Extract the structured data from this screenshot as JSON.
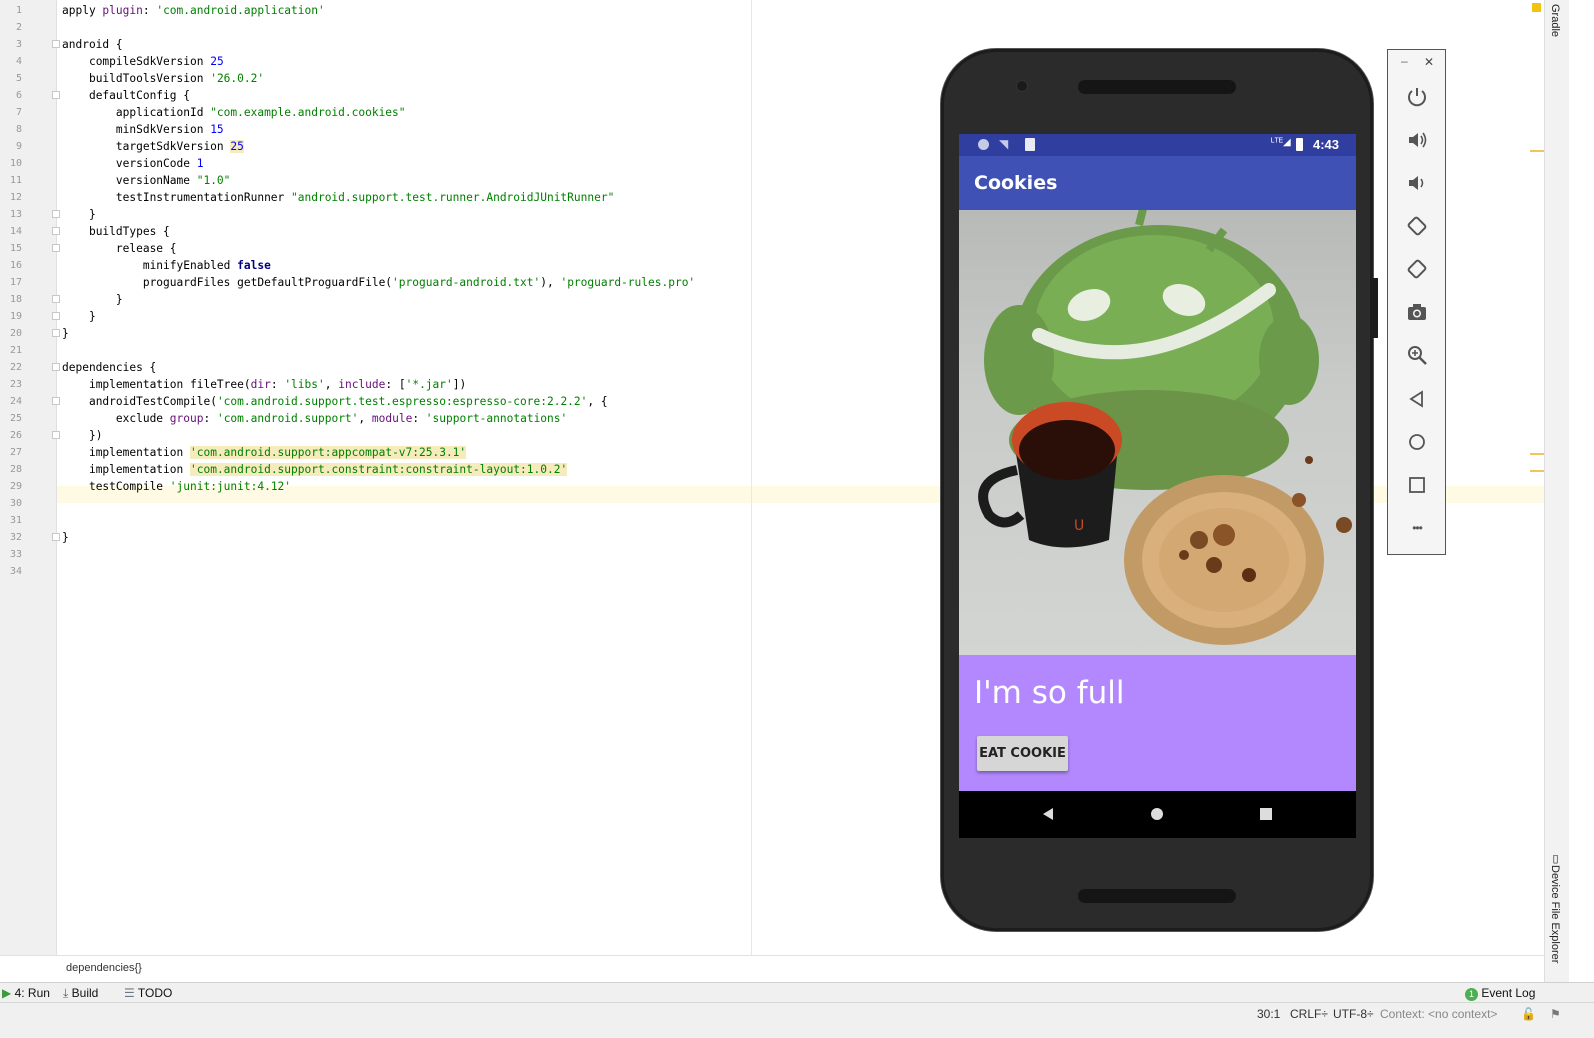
{
  "editor": {
    "line_numbers": [
      "1",
      "2",
      "3",
      "4",
      "5",
      "6",
      "7",
      "8",
      "9",
      "10",
      "11",
      "12",
      "13",
      "14",
      "15",
      "16",
      "17",
      "18",
      "19",
      "20",
      "21",
      "22",
      "23",
      "24",
      "25",
      "26",
      "27",
      "28",
      "29",
      "30",
      "31",
      "32",
      "33",
      "34"
    ],
    "lines": [
      {
        "n": 1,
        "indent": "",
        "parts": [
          [
            "",
            "apply "
          ],
          [
            "prop",
            "plugin"
          ],
          [
            "",
            ": "
          ],
          [
            "str",
            "'com.android.application'"
          ]
        ]
      },
      {
        "n": 2,
        "indent": "",
        "parts": []
      },
      {
        "n": 3,
        "indent": "",
        "parts": [
          [
            "",
            "android {"
          ]
        ]
      },
      {
        "n": 4,
        "indent": "    ",
        "parts": [
          [
            "",
            "compileSdkVersion "
          ],
          [
            "num",
            "25"
          ]
        ]
      },
      {
        "n": 5,
        "indent": "    ",
        "parts": [
          [
            "",
            "buildToolsVersion "
          ],
          [
            "str",
            "'26.0.2'"
          ]
        ]
      },
      {
        "n": 6,
        "indent": "    ",
        "parts": [
          [
            "",
            "defaultConfig {"
          ]
        ]
      },
      {
        "n": 7,
        "indent": "        ",
        "parts": [
          [
            "",
            "applicationId "
          ],
          [
            "str",
            "\"com.example.android.cookies\""
          ]
        ]
      },
      {
        "n": 8,
        "indent": "        ",
        "parts": [
          [
            "",
            "minSdkVersion "
          ],
          [
            "num",
            "15"
          ]
        ]
      },
      {
        "n": 9,
        "indent": "        ",
        "parts": [
          [
            "",
            "targetSdkVersion "
          ],
          [
            "num hl",
            "25"
          ]
        ]
      },
      {
        "n": 10,
        "indent": "        ",
        "parts": [
          [
            "",
            "versionCode "
          ],
          [
            "num",
            "1"
          ]
        ]
      },
      {
        "n": 11,
        "indent": "        ",
        "parts": [
          [
            "",
            "versionName "
          ],
          [
            "str",
            "\"1.0\""
          ]
        ]
      },
      {
        "n": 12,
        "indent": "        ",
        "parts": [
          [
            "",
            "testInstrumentationRunner "
          ],
          [
            "str",
            "\"android.support.test.runner.AndroidJUnitRunner\""
          ]
        ]
      },
      {
        "n": 13,
        "indent": "    ",
        "parts": [
          [
            "",
            "}"
          ]
        ]
      },
      {
        "n": 14,
        "indent": "    ",
        "parts": [
          [
            "",
            "buildTypes {"
          ]
        ]
      },
      {
        "n": 15,
        "indent": "        ",
        "parts": [
          [
            "",
            "release {"
          ]
        ]
      },
      {
        "n": 16,
        "indent": "            ",
        "parts": [
          [
            "",
            "minifyEnabled "
          ],
          [
            "kw",
            "false"
          ]
        ]
      },
      {
        "n": 17,
        "indent": "            ",
        "parts": [
          [
            "",
            "proguardFiles getDefaultProguardFile("
          ],
          [
            "str",
            "'proguard-android.txt'"
          ],
          [
            "",
            "), "
          ],
          [
            "str",
            "'proguard-rules.pro'"
          ]
        ]
      },
      {
        "n": 18,
        "indent": "        ",
        "parts": [
          [
            "",
            "}"
          ]
        ]
      },
      {
        "n": 19,
        "indent": "    ",
        "parts": [
          [
            "",
            "}"
          ]
        ]
      },
      {
        "n": 20,
        "indent": "",
        "parts": [
          [
            "",
            "}"
          ]
        ]
      },
      {
        "n": 21,
        "indent": "",
        "parts": []
      },
      {
        "n": 22,
        "indent": "",
        "parts": [
          [
            "",
            "dependencies {"
          ]
        ]
      },
      {
        "n": 23,
        "indent": "    ",
        "parts": [
          [
            "",
            "implementation fileTree("
          ],
          [
            "prop",
            "dir"
          ],
          [
            "",
            ": "
          ],
          [
            "str",
            "'libs'"
          ],
          [
            "",
            ", "
          ],
          [
            "prop",
            "include"
          ],
          [
            "",
            ": ["
          ],
          [
            "str",
            "'*.jar'"
          ],
          [
            "",
            "])"
          ]
        ]
      },
      {
        "n": 24,
        "indent": "    ",
        "parts": [
          [
            "",
            "androidTestCompile("
          ],
          [
            "str",
            "'com.android.support.test.espresso:espresso-core:2.2.2'"
          ],
          [
            "",
            ", {"
          ]
        ]
      },
      {
        "n": 25,
        "indent": "        ",
        "parts": [
          [
            "",
            "exclude "
          ],
          [
            "prop",
            "group"
          ],
          [
            "",
            ": "
          ],
          [
            "str",
            "'com.android.support'"
          ],
          [
            "",
            ", "
          ],
          [
            "prop",
            "module"
          ],
          [
            "",
            ": "
          ],
          [
            "str",
            "'support-annotations'"
          ]
        ]
      },
      {
        "n": 26,
        "indent": "    ",
        "parts": [
          [
            "",
            "})"
          ]
        ]
      },
      {
        "n": 27,
        "indent": "    ",
        "parts": [
          [
            "",
            "implementation "
          ],
          [
            "str hl",
            "'com.android.support:appcompat-v7:25.3.1'"
          ]
        ]
      },
      {
        "n": 28,
        "indent": "    ",
        "parts": [
          [
            "",
            "implementation "
          ],
          [
            "str hl",
            "'com.android.support.constraint:constraint-layout:1.0.2'"
          ]
        ]
      },
      {
        "n": 29,
        "indent": "    ",
        "parts": [
          [
            "",
            "testCompile "
          ],
          [
            "str",
            "'junit:junit:4.12'"
          ]
        ]
      },
      {
        "n": 30,
        "indent": "",
        "parts": []
      },
      {
        "n": 31,
        "indent": "",
        "parts": []
      },
      {
        "n": 32,
        "indent": "",
        "parts": [
          [
            "",
            "}"
          ]
        ]
      },
      {
        "n": 33,
        "indent": "",
        "parts": []
      },
      {
        "n": 34,
        "indent": "",
        "parts": []
      }
    ],
    "breadcrumb": "dependencies{}"
  },
  "right_tools": {
    "gradle": "Gradle",
    "device_explorer": "Device File Explorer"
  },
  "bottom_tools": {
    "run": "4: Run",
    "build": "Build",
    "todo": "TODO",
    "event_log": "Event Log",
    "event_count": "1"
  },
  "status": {
    "position": "30:1",
    "line_sep": "CRLF÷",
    "encoding": "UTF-8÷",
    "context": "Context: <no context>"
  },
  "phone": {
    "time": "4:43",
    "app_title": "Cookies",
    "status_message": "I'm so full",
    "button_label": "EAT COOKIE"
  },
  "emulator_panel": {
    "minimize": "–",
    "close": "✕",
    "more": "•••"
  }
}
